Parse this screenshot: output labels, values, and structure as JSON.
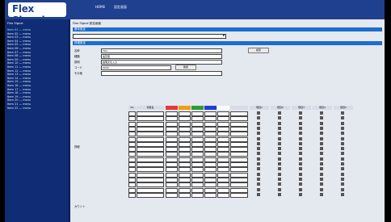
{
  "app": {
    "logo": "Flex Signal",
    "nav": [
      "HOME",
      "設定画面"
    ]
  },
  "sidebar": {
    "title": "Flex Signal",
    "items": [
      {
        "label": "Item 01 — menu",
        "active": true
      },
      {
        "label": "Item 02 — menu"
      },
      {
        "label": "Item 03 — menu"
      },
      {
        "label": "Item 04 — menu"
      },
      {
        "label": "Item 05 — menu"
      },
      {
        "label": "Item 06 — menu"
      },
      {
        "label": "Item 07 — menu"
      },
      {
        "label": "Item 08 — menu"
      },
      {
        "label": "Item 09 — menu"
      },
      {
        "label": "Item 10 — menu"
      },
      {
        "label": "Item 11 — menu"
      },
      {
        "label": "Item 12 — menu"
      },
      {
        "label": "Item 13 — menu"
      },
      {
        "label": "Item 14 — menu"
      },
      {
        "label": "Item 15 — menu"
      },
      {
        "label": "Item 16 — menu"
      },
      {
        "label": "Item 17 — menu"
      },
      {
        "label": "Item 18 — menu"
      },
      {
        "label": "Item 19 — menu"
      },
      {
        "label": "Item 20 — menu"
      },
      {
        "label": "Item 21 — menu"
      },
      {
        "label": "Item 22 — menu"
      }
    ]
  },
  "main": {
    "title": "Flex Signal 設定画面",
    "section1": "基本設定",
    "section2": "詳細設定",
    "select_value": "",
    "rows": [
      {
        "label": "名称",
        "value": "Flex",
        "button": "検索"
      },
      {
        "label": "種類",
        "value": "設定値"
      },
      {
        "label": "説明",
        "value": "説明文を入力"
      },
      {
        "label": "コード",
        "value": "0000",
        "button": "確認"
      },
      {
        "label": "その他",
        "value": ""
      }
    ],
    "grid_label": "詳細",
    "counter_label": "カウント",
    "table_headers": [
      "No",
      "項目名",
      "",
      "",
      "",
      "",
      "",
      "",
      "項目1",
      "項目2",
      "項目3",
      "項目4",
      "項目5"
    ],
    "swatches": [
      "#e53935",
      "#f39c12",
      "#2e9b37",
      "#1f3fd0",
      "#fafafa"
    ],
    "table_rows": 17
  },
  "colors": {
    "header_bg": "#1f3f8f",
    "sidebar_bg": "#0f2c74",
    "accent_bar": "#1c6dd0"
  }
}
